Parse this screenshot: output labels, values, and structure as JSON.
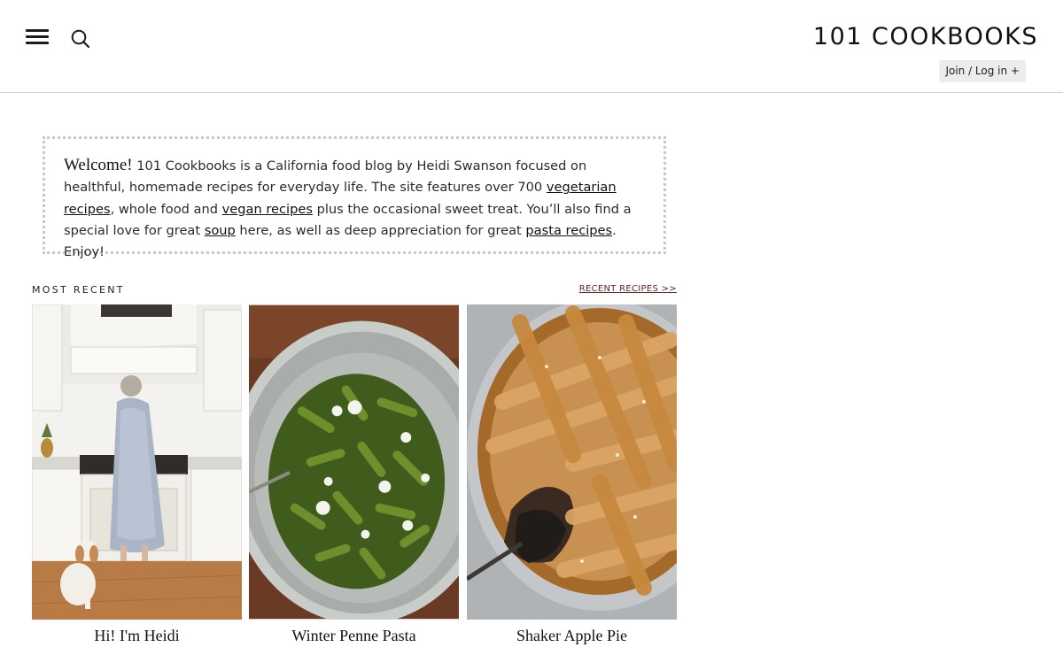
{
  "header": {
    "logo": "101 COOKBOOKS",
    "login_label": "Join / Log in +"
  },
  "welcome": {
    "lead": "Welcome!",
    "text_1": " 101 Cookbooks is a California food blog by Heidi Swanson focused on healthful, homemade recipes for everyday life. The site features over 700 ",
    "link_vegetarian": "vegetarian recipes",
    "text_2": ", whole food and ",
    "link_vegan": "vegan recipes",
    "text_3": " plus the occasional sweet treat. You’ll also find a special love for great ",
    "link_soup": "soup",
    "text_4": " here, as well as deep appreciation for great ",
    "link_pasta": "pasta recipes",
    "text_5": ". Enjoy!"
  },
  "most_recent": {
    "title": "MOST RECENT",
    "link": "RECENT RECIPES >>"
  },
  "cards": [
    {
      "caption": "Hi! I'm Heidi"
    },
    {
      "caption": "Winter Penne Pasta"
    },
    {
      "caption": "Shaker Apple Pie"
    }
  ],
  "colors": {
    "accent_link": "#6a2323",
    "border": "#c9c9c9"
  },
  "icons": [
    "menu-icon",
    "search-icon"
  ]
}
